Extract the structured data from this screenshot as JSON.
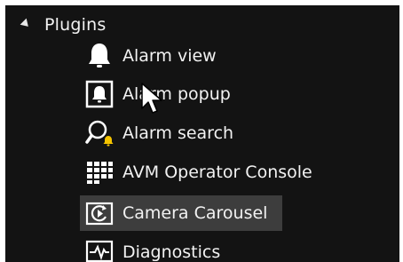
{
  "tree": {
    "group_label": "Plugins",
    "items": [
      {
        "label": "Alarm view",
        "icon": "bell-icon"
      },
      {
        "label": "Alarm popup",
        "icon": "bell-popup-icon"
      },
      {
        "label": "Alarm search",
        "icon": "alarm-search-icon"
      },
      {
        "label": "AVM Operator Console",
        "icon": "operator-console-grid-icon"
      },
      {
        "label": "Camera Carousel",
        "icon": "camera-carousel-icon",
        "selected": true
      },
      {
        "label": "Diagnostics",
        "icon": "diagnostics-icon"
      }
    ]
  },
  "colors": {
    "panel_background": "#131313",
    "selected_row": "#3d3d3d",
    "text": "#f2f2f2",
    "accent_yellow": "#f5c400"
  }
}
